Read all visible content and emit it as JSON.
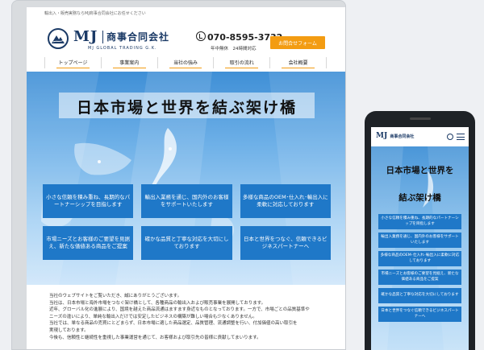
{
  "desktop": {
    "top_note": "輸出入・販売実務ならMJ商事合同会社にお任せください",
    "logo": {
      "mark": "MJ",
      "name_jp": "商事合同会社",
      "name_en": "MJ GLOBAL TRADING G.K."
    },
    "phone": "070-8595-3732",
    "hours": "年中無休　24時間対応",
    "contact_button": "お問合せフォーム",
    "nav": [
      "トップページ",
      "事業案内",
      "当社の強み",
      "取引の流れ",
      "会社概要"
    ],
    "hero_title": "日本市場と世界を結ぶ架け橋",
    "cards": [
      "小さな信頼を積み重ね、長期的なパートナーシップを目指します",
      "輸出入業務を通じ、国内外のお客様をサポートいたします",
      "多様な商品のOEM･仕入れ･輸出入に柔軟に対応しております",
      "市場ニーズとお客様のご要望を見据え、新たな価値ある商品をご提案",
      "確かな品質と丁寧な対応を大切にしております",
      "日本と世界をつなぐ、信頼できるビジネスパートナーへ"
    ],
    "body_lines": [
      "当社のウェブサイトをご覧いただき、誠にありがとうございます。",
      "当社は、日本市場と海外市場をつなぐ架け橋として、各種商品の輸出入および販売事業を展開しております。",
      "近年、グローバル化の進展により、国境を越えた商品流通はますます身近なものとなっております。一方で、市場ごとの品質基準や",
      "ニーズの違いにより、単純な輸出入だけでは安定したビジネスの構築が難しい場合も少なくありません。",
      "当社では、単なる商品の売買にとどまらず、日本市場に適した商品選定、品質管理、流通調整を行い、付加価値の高い取引を",
      "実現しております。",
      "今後も、信頼性と継続性を重視した事業運営を通じて、お客様および取引先の皆様に貢献してまいります。"
    ]
  },
  "mobile": {
    "logo_mark": "MJ",
    "logo_text": "商事合同会社",
    "hero_title_line1": "日本市場と世界を",
    "hero_title_line2": "結ぶ架け橋",
    "cards": [
      "小さな信頼を積み重ね、長期的なパートナーシップを目指します",
      "輸出入業務を通じ、国内外のお客様をサポートいたします",
      "多様な商品のOEM･仕入れ･輸出入に柔軟に対応しております",
      "市場ニーズとお客様のご要望を見据え、新たな価値ある商品をご提案",
      "確かな品質と丁寧な対応を大切にしております",
      "日本と世界をつなぐ信頼できるビジネスパートナーへ"
    ]
  },
  "colors": {
    "brand_navy": "#1b3a66",
    "accent_orange": "#f39c12",
    "card_blue": "#1f78c8"
  }
}
